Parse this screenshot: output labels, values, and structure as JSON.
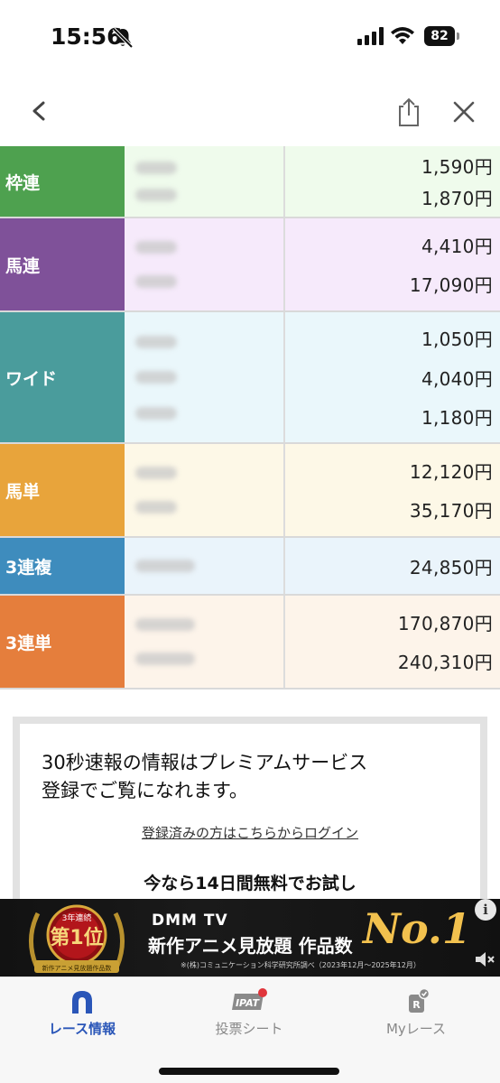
{
  "status_bar": {
    "time": "15:56",
    "battery": "82"
  },
  "payouts": [
    {
      "label": "枠連",
      "color": "#4ea14f",
      "bg": "#effbec",
      "combos": [
        "short",
        "short"
      ],
      "amounts": [
        "1,590円",
        "1,870円"
      ]
    },
    {
      "label": "馬連",
      "color": "#7f5199",
      "bg": "#f6eafb",
      "combos": [
        "short",
        "short"
      ],
      "amounts": [
        "4,410円",
        "17,090円"
      ]
    },
    {
      "label": "ワイド",
      "color": "#4a9c9c",
      "bg": "#eaf7fb",
      "combos": [
        "short",
        "short",
        "short"
      ],
      "amounts": [
        "1,050円",
        "4,040円",
        "1,180円"
      ]
    },
    {
      "label": "馬単",
      "color": "#e8a43b",
      "bg": "#fdf8e7",
      "combos": [
        "short",
        "short"
      ],
      "amounts": [
        "12,120円",
        "35,170円"
      ]
    },
    {
      "label": "3連複",
      "color": "#3e8cbd",
      "bg": "#eaf4fb",
      "combos": [
        "long"
      ],
      "amounts": [
        "24,850円"
      ]
    },
    {
      "label": "3連単",
      "color": "#e57e3c",
      "bg": "#fdf4ea",
      "combos": [
        "long",
        "long"
      ],
      "amounts": [
        "170,870円",
        "240,310円"
      ]
    }
  ],
  "premium": {
    "message_line1": "30秒速報の情報はプレミアムサービス",
    "message_line2": "登録でご覧になれます。",
    "login_link": "登録済みの方はこちらからログイン",
    "trial": "今なら14日間無料でお試し"
  },
  "ad": {
    "badge_top": "3年連続",
    "badge_main": "第1位",
    "badge_sub": "新作アニメ見放題作品数",
    "brand": "DMM TV",
    "headline": "新作アニメ見放題 作品数",
    "no1": "No.1",
    "note": "※(株)コミュニケーション科学研究所調べ（2023年12月〜2025年12月）",
    "info": "i"
  },
  "tabs": [
    {
      "label": "レース情報",
      "icon": "horseshoe-icon",
      "active": true
    },
    {
      "label": "投票シート",
      "icon": "ipat-icon",
      "badge_text": "IPAT",
      "active": false
    },
    {
      "label": "Myレース",
      "icon": "my-race-icon",
      "badge_text": "R",
      "active": false
    }
  ],
  "colors": {
    "accent": "#2a56b8",
    "notification": "#e0353b"
  }
}
